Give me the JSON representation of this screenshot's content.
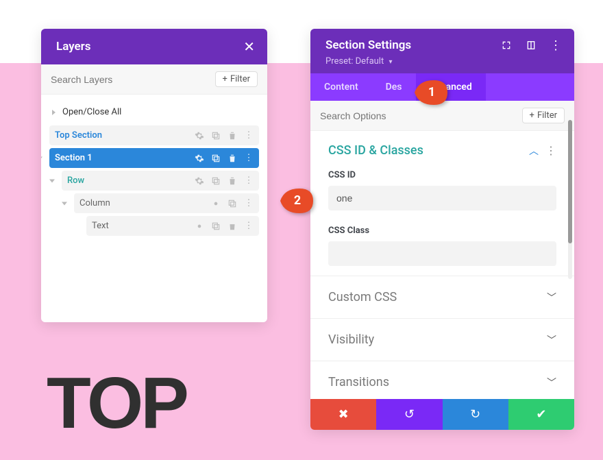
{
  "layers": {
    "title": "Layers",
    "search_placeholder": "Search Layers",
    "filter_label": "Filter",
    "open_close": "Open/Close All",
    "items": [
      {
        "label": "Top Section"
      },
      {
        "label": "Section 1"
      },
      {
        "label": "Row"
      },
      {
        "label": "Column"
      },
      {
        "label": "Text"
      }
    ]
  },
  "settings": {
    "title": "Section Settings",
    "preset_prefix": "Preset:",
    "preset_value": "Default",
    "tabs": {
      "content": "Content",
      "design": "Des",
      "advanced": "Advanced"
    },
    "search_placeholder": "Search Options",
    "filter_label": "Filter",
    "sections": {
      "css_id_classes": {
        "title": "CSS ID & Classes",
        "css_id_label": "CSS ID",
        "css_id_value": "one",
        "css_class_label": "CSS Class",
        "css_class_value": ""
      },
      "custom_css": "Custom CSS",
      "visibility": "Visibility",
      "transitions": "Transitions"
    }
  },
  "annotations": {
    "a1": "1",
    "a2": "2"
  },
  "page_text": "TOP"
}
